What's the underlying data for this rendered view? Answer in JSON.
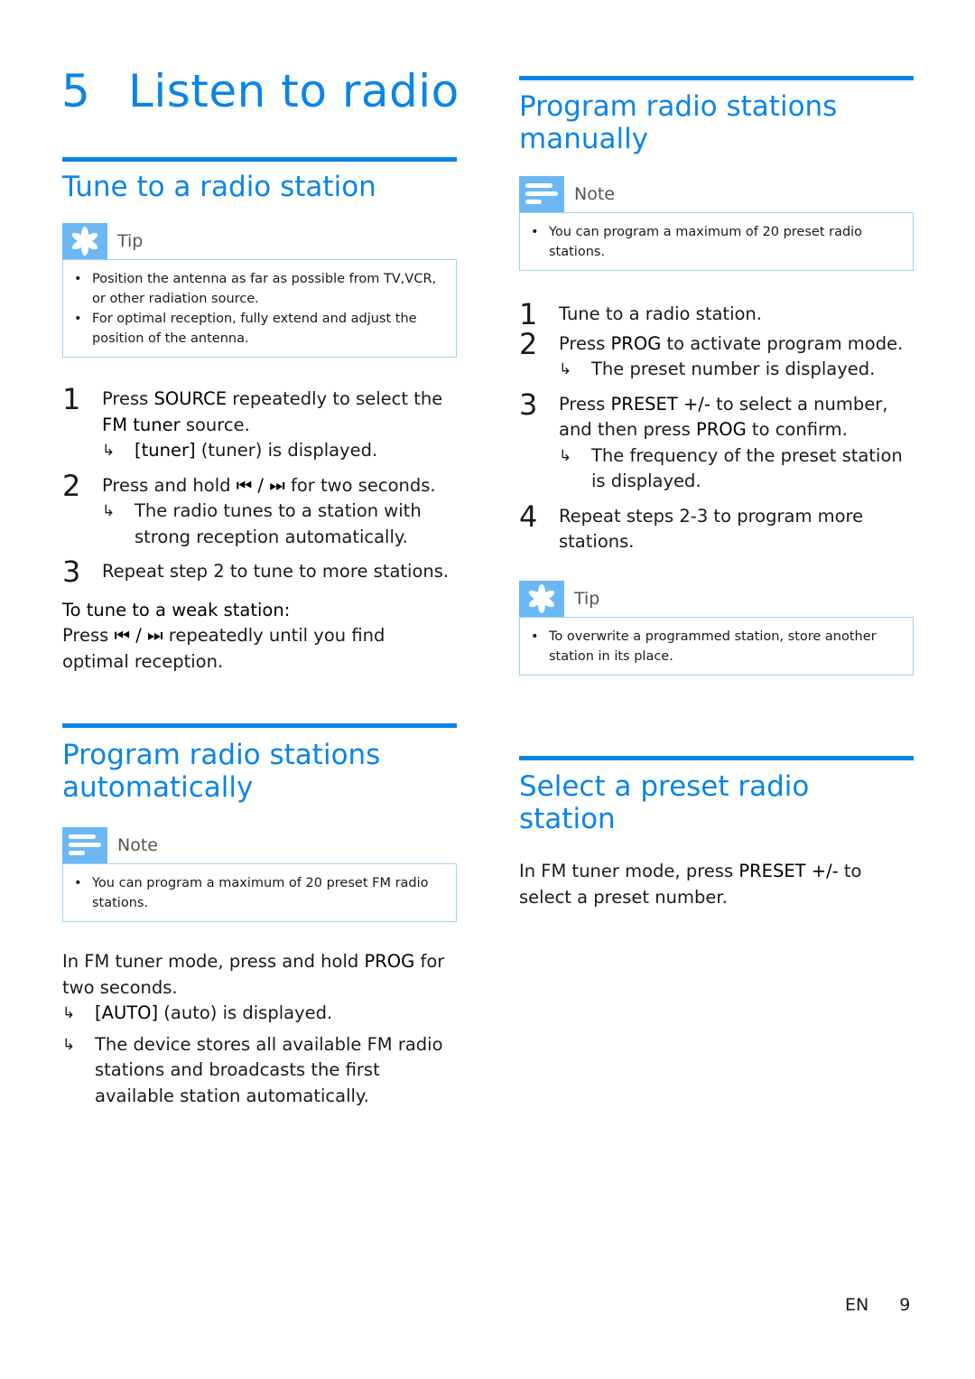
{
  "chapter": {
    "number": "5",
    "title": "Listen to radio"
  },
  "sections": {
    "tune": {
      "heading": "Tune to a radio station",
      "tip_label": "Tip",
      "tips": [
        "Position the antenna as far as possible from TV,VCR, or other radiation source.",
        "For optimal reception, fully extend and adjust the position of the antenna."
      ],
      "step1_pre": "Press ",
      "step1_key": "SOURCE",
      "step1_mid": " repeatedly to select the ",
      "step1_key2": "FM tuner",
      "step1_post": " source.",
      "step1_res_key": "[tuner]",
      "step1_res": " (tuner) is displayed.",
      "step2_pre": "Press and hold ",
      "step2_keys": "⏮ / ⏭",
      "step2_post": " for two seconds.",
      "step2_res": "The radio tunes to a station with strong reception automatically.",
      "step3": "Repeat step 2 to tune to more stations.",
      "weak_heading": "To tune to a weak station:",
      "weak_pre": "Press ",
      "weak_keys": "⏮ / ⏭",
      "weak_post": " repeatedly until you find optimal reception."
    },
    "auto": {
      "heading": "Program radio stations automatically",
      "note_label": "Note",
      "notes": [
        "You can program a maximum of 20 preset FM radio stations."
      ],
      "para_pre": "In FM tuner mode, press and hold ",
      "para_key": "PROG",
      "para_post": " for two seconds.",
      "res1_key": "[AUTO]",
      "res1": " (auto) is displayed.",
      "res2": "The device stores all available FM radio stations and broadcasts the first available station automatically."
    },
    "manual": {
      "heading": "Program radio stations manually",
      "note_label": "Note",
      "notes": [
        "You can program a maximum of 20 preset radio stations."
      ],
      "step1": "Tune to a radio station.",
      "step2_pre": "Press ",
      "step2_key": "PROG",
      "step2_post": " to activate program mode.",
      "step2_res": "The preset number is displayed.",
      "step3_pre": "Press ",
      "step3_key": "PRESET +/-",
      "step3_mid": " to select a number, and then press ",
      "step3_key2": "PROG",
      "step3_post": " to confirm.",
      "step3_res": "The frequency of the preset station is displayed.",
      "step4": "Repeat steps 2-3 to program more stations.",
      "tip_label": "Tip",
      "tips": [
        "To overwrite a programmed station, store another station in its place."
      ]
    },
    "select": {
      "heading": "Select a preset radio station",
      "para_pre": "In FM tuner mode, press ",
      "para_key": "PRESET +/-",
      "para_post": " to select a preset number."
    }
  },
  "footer": {
    "lang": "EN",
    "page": "9"
  },
  "step_numbers": [
    "1",
    "2",
    "3",
    "4"
  ],
  "arrow": "↳"
}
